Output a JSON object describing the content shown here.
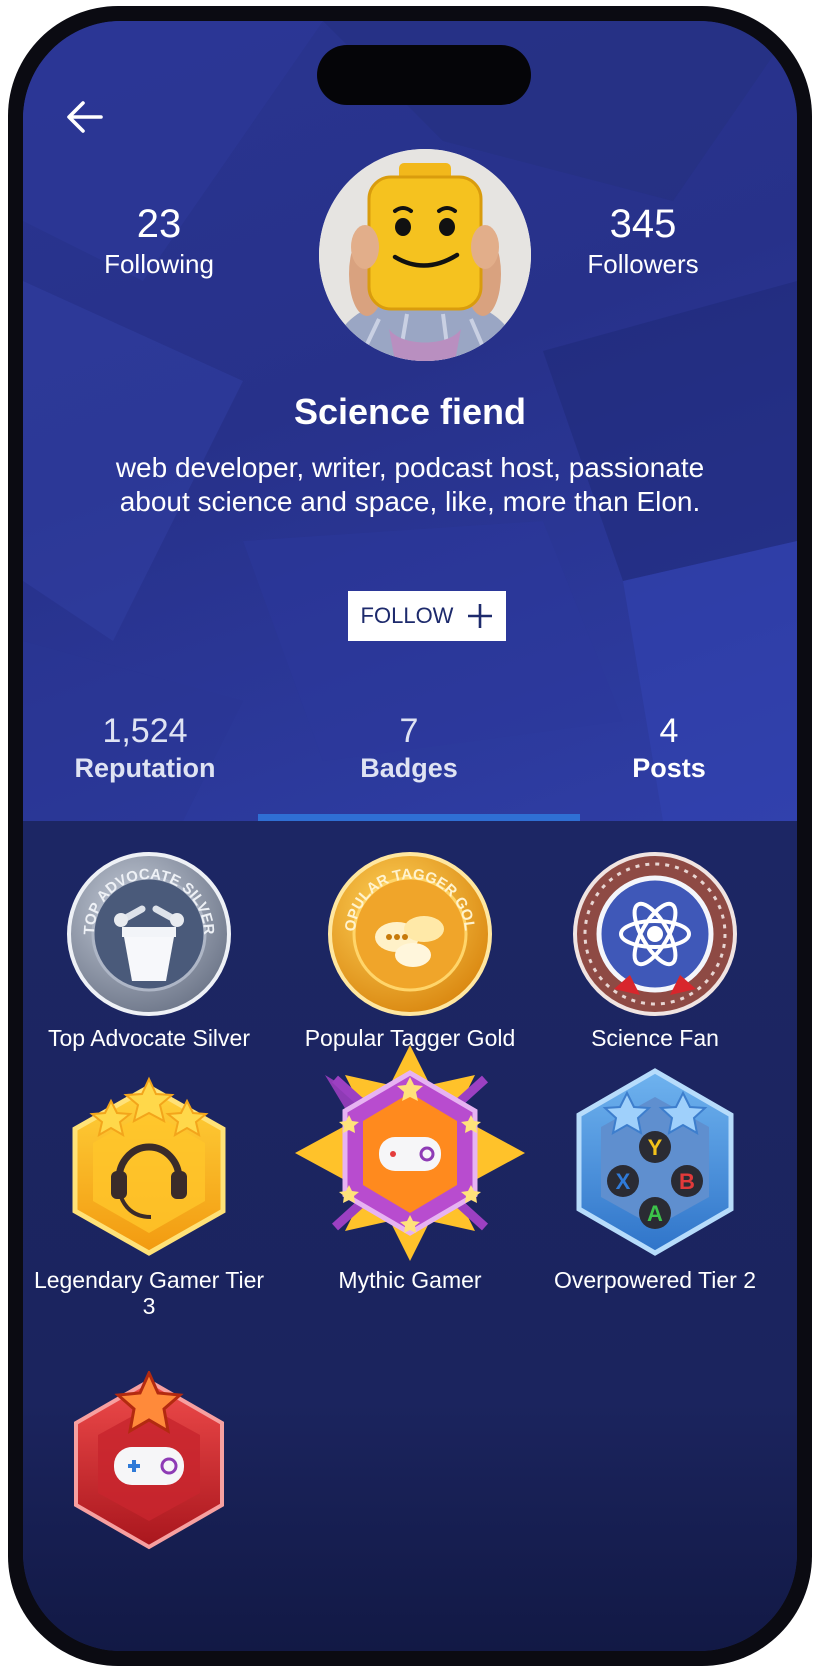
{
  "profile": {
    "name": "Science fiend",
    "bio": "web developer, writer, podcast host, passionate about science and space, like, more than Elon.",
    "following_count": "23",
    "following_label": "Following",
    "followers_count": "345",
    "followers_label": "Followers",
    "follow_button_label": "FOLLOW"
  },
  "tabs": [
    {
      "count": "1,524",
      "label": "Reputation",
      "selected": false
    },
    {
      "count": "7",
      "label": "Badges",
      "selected": true
    },
    {
      "count": "4",
      "label": "Posts",
      "selected": false
    }
  ],
  "badges": [
    {
      "name": "Top Advocate Silver",
      "icon": "top-advocate-silver-icon",
      "ring_text": "TOP ADVOCATE SILVER"
    },
    {
      "name": "Popular Tagger Gold",
      "icon": "popular-tagger-gold-icon",
      "ring_text": "POPULAR TAGGER GOLD"
    },
    {
      "name": "Science Fan",
      "icon": "science-fan-icon"
    },
    {
      "name": "Legendary Gamer Tier 3",
      "icon": "legendary-gamer-icon"
    },
    {
      "name": "Mythic Gamer",
      "icon": "mythic-gamer-icon"
    },
    {
      "name": "Overpowered Tier 2",
      "icon": "overpowered-icon",
      "button_letters": [
        "Y",
        "X",
        "B",
        "A"
      ]
    },
    {
      "name": "",
      "icon": "red-gamer-badge-icon"
    }
  ],
  "colors": {
    "hero": "#2a3590",
    "badges_background": "#1c2461",
    "tab_indicator": "#2f6fd4",
    "follow_text": "#1d2a6c"
  }
}
